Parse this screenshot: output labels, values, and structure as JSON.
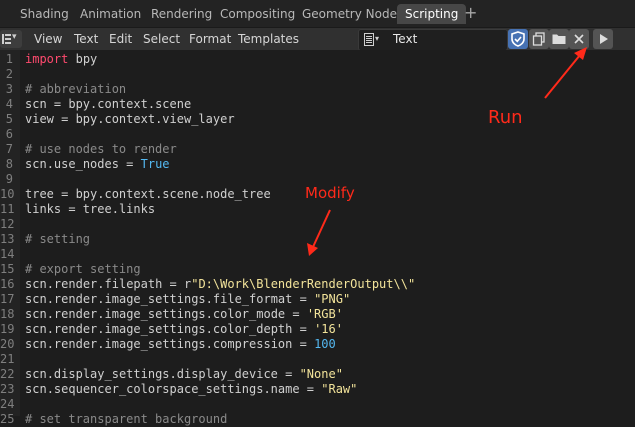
{
  "workspace_tabs": [
    {
      "label": "Shading"
    },
    {
      "label": "Animation"
    },
    {
      "label": "Rendering"
    },
    {
      "label": "Compositing"
    },
    {
      "label": "Geometry Nodes"
    },
    {
      "label": "Scripting"
    }
  ],
  "active_tab": "Scripting",
  "tab_add": "+",
  "menu": {
    "view": "View",
    "text": "Text",
    "edit": "Edit",
    "select": "Select",
    "format": "Format",
    "templates": "Templates"
  },
  "text_selector": {
    "value": "Text"
  },
  "icons": {
    "editor_type": "text-editor-icon",
    "fake_user": "shield-icon",
    "duplicate": "duplicate-icon",
    "open": "folder-icon",
    "unlink": "close-icon",
    "run": "play-icon"
  },
  "colors": {
    "annotation": "#ff2a1a",
    "keyword": "#ff4a6e",
    "string": "#f2e39a",
    "number": "#54b8f0",
    "active_button": "#4772b3"
  },
  "annotations": {
    "run": "Run",
    "modify": "Modify"
  },
  "lines": [
    {
      "n": "1",
      "segs": [
        [
          "kw",
          "import"
        ],
        [
          "",
          "bpy"
        ]
      ]
    },
    {
      "n": "2",
      "segs": []
    },
    {
      "n": "3",
      "segs": [
        [
          "cm",
          "# abbreviation"
        ]
      ]
    },
    {
      "n": "4",
      "segs": [
        [
          "",
          "scn = bpy"
        ],
        [
          "dot",
          "."
        ],
        [
          "",
          "context"
        ],
        [
          "dot",
          "."
        ],
        [
          "",
          "scene"
        ]
      ]
    },
    {
      "n": "5",
      "segs": [
        [
          "",
          "view = bpy"
        ],
        [
          "dot",
          "."
        ],
        [
          "",
          "context"
        ],
        [
          "dot",
          "."
        ],
        [
          "",
          "view_layer"
        ]
      ]
    },
    {
      "n": "6",
      "segs": []
    },
    {
      "n": "7",
      "segs": [
        [
          "cm",
          "# use nodes to render"
        ]
      ]
    },
    {
      "n": "8",
      "segs": [
        [
          "",
          "scn"
        ],
        [
          "dot",
          "."
        ],
        [
          "",
          "use_nodes = "
        ],
        [
          "nm",
          "True"
        ]
      ]
    },
    {
      "n": "9",
      "segs": []
    },
    {
      "n": "10",
      "segs": [
        [
          "",
          "tree = bpy"
        ],
        [
          "dot",
          "."
        ],
        [
          "",
          "context"
        ],
        [
          "dot",
          "."
        ],
        [
          "",
          "scene"
        ],
        [
          "dot",
          "."
        ],
        [
          "",
          "node_tree"
        ]
      ]
    },
    {
      "n": "11",
      "segs": [
        [
          "",
          "links = tree"
        ],
        [
          "dot",
          "."
        ],
        [
          "",
          "links"
        ]
      ]
    },
    {
      "n": "12",
      "segs": []
    },
    {
      "n": "13",
      "segs": [
        [
          "cm",
          "# setting"
        ]
      ]
    },
    {
      "n": "14",
      "segs": []
    },
    {
      "n": "15",
      "segs": [
        [
          "cm",
          "# export setting"
        ]
      ]
    },
    {
      "n": "16",
      "segs": [
        [
          "",
          "scn"
        ],
        [
          "dot",
          "."
        ],
        [
          "",
          "render"
        ],
        [
          "dot",
          "."
        ],
        [
          "",
          "filepath = r"
        ],
        [
          "st",
          "\"D:\\Work\\BlenderRenderOutput\\\\\""
        ]
      ]
    },
    {
      "n": "17",
      "segs": [
        [
          "",
          "scn"
        ],
        [
          "dot",
          "."
        ],
        [
          "",
          "render"
        ],
        [
          "dot",
          "."
        ],
        [
          "",
          "image_settings"
        ],
        [
          "dot",
          "."
        ],
        [
          "",
          "file_format = "
        ],
        [
          "st",
          "\"PNG\""
        ]
      ]
    },
    {
      "n": "18",
      "segs": [
        [
          "",
          "scn"
        ],
        [
          "dot",
          "."
        ],
        [
          "",
          "render"
        ],
        [
          "dot",
          "."
        ],
        [
          "",
          "image_settings"
        ],
        [
          "dot",
          "."
        ],
        [
          "",
          "color_mode = "
        ],
        [
          "st",
          "'RGB'"
        ]
      ]
    },
    {
      "n": "19",
      "segs": [
        [
          "",
          "scn"
        ],
        [
          "dot",
          "."
        ],
        [
          "",
          "render"
        ],
        [
          "dot",
          "."
        ],
        [
          "",
          "image_settings"
        ],
        [
          "dot",
          "."
        ],
        [
          "",
          "color_depth = "
        ],
        [
          "st",
          "'16'"
        ]
      ]
    },
    {
      "n": "20",
      "segs": [
        [
          "",
          "scn"
        ],
        [
          "dot",
          "."
        ],
        [
          "",
          "render"
        ],
        [
          "dot",
          "."
        ],
        [
          "",
          "image_settings"
        ],
        [
          "dot",
          "."
        ],
        [
          "",
          "compression = "
        ],
        [
          "nm",
          "100"
        ]
      ]
    },
    {
      "n": "21",
      "segs": []
    },
    {
      "n": "22",
      "segs": [
        [
          "",
          "scn"
        ],
        [
          "dot",
          "."
        ],
        [
          "",
          "display_settings"
        ],
        [
          "dot",
          "."
        ],
        [
          "",
          "display_device = "
        ],
        [
          "st",
          "\"None\""
        ]
      ]
    },
    {
      "n": "23",
      "segs": [
        [
          "",
          "scn"
        ],
        [
          "dot",
          "."
        ],
        [
          "",
          "sequencer_colorspace_settings"
        ],
        [
          "dot",
          "."
        ],
        [
          "",
          "name = "
        ],
        [
          "st",
          "\"Raw\""
        ]
      ]
    },
    {
      "n": "24",
      "segs": []
    },
    {
      "n": "25",
      "segs": [
        [
          "cm",
          "# set transparent background"
        ]
      ]
    }
  ]
}
